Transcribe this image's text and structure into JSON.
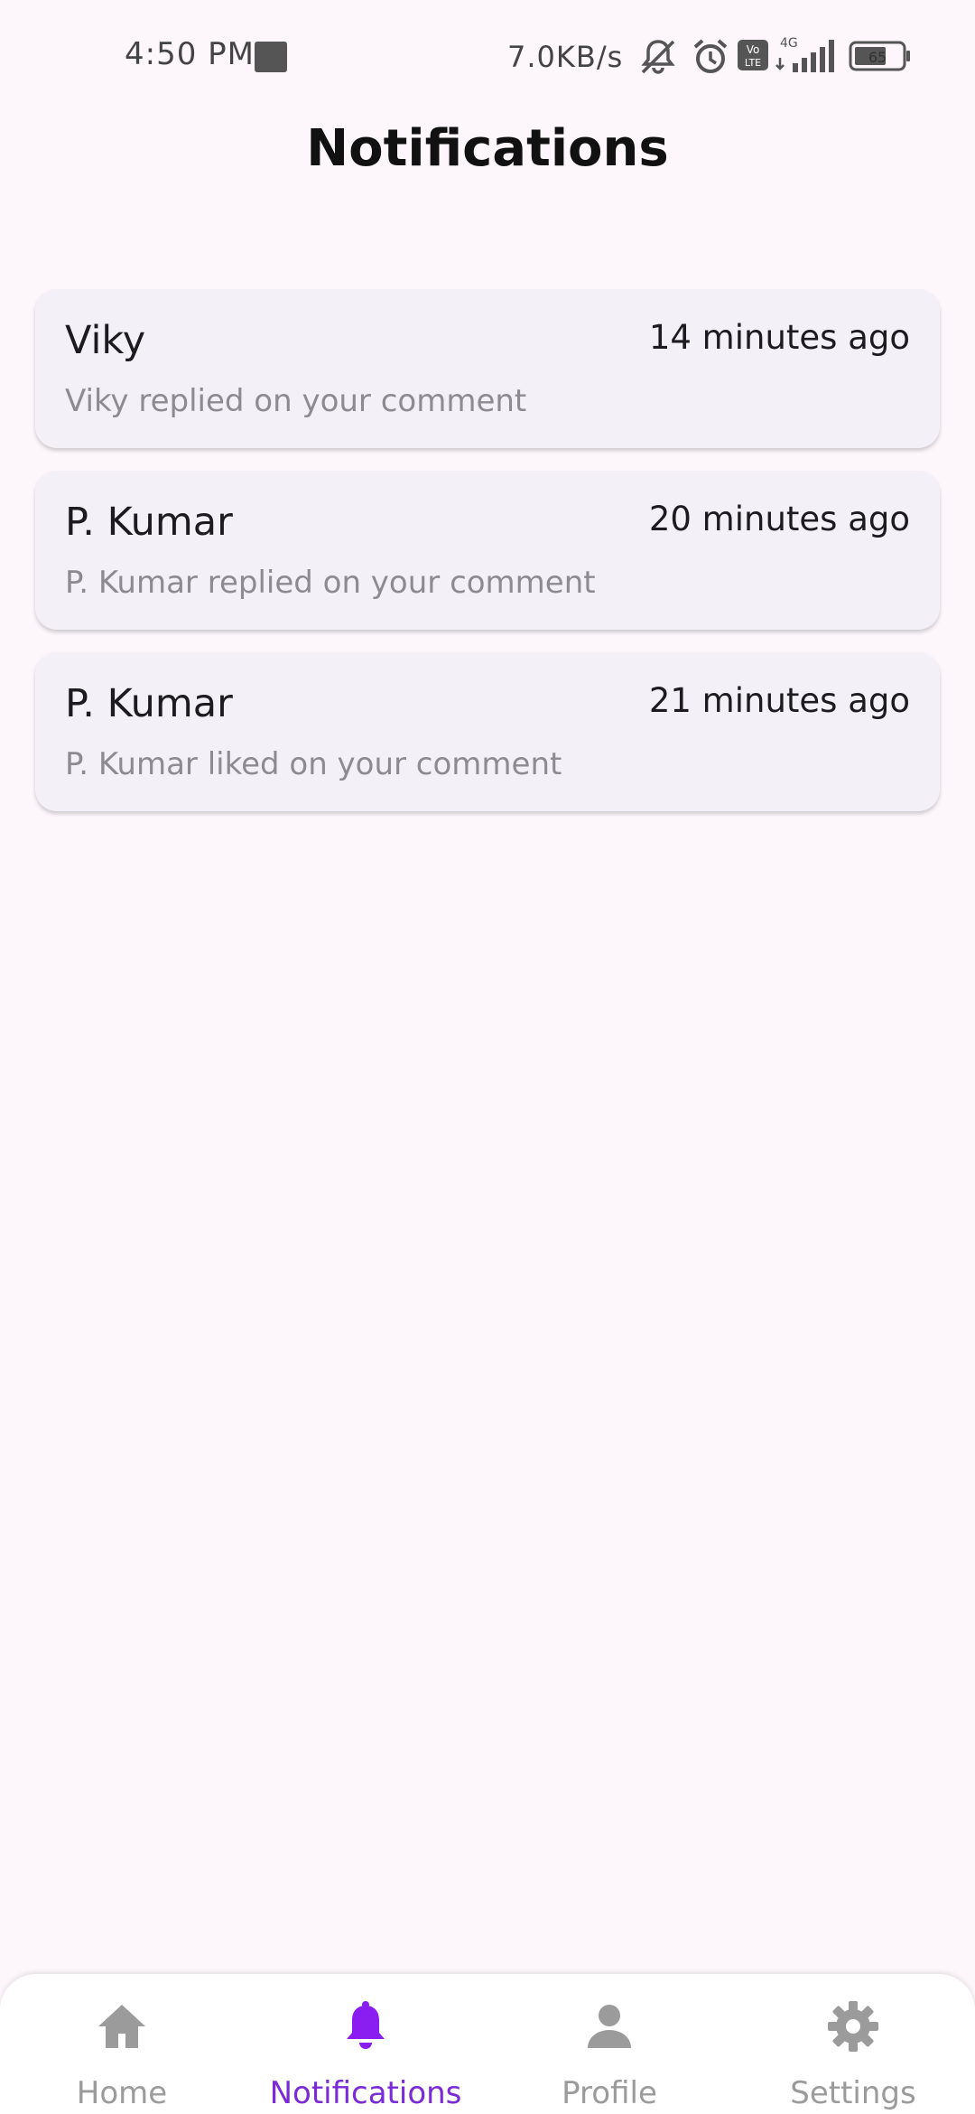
{
  "status_bar": {
    "time": "4:50 PM",
    "net_speed": "7.0KB/s",
    "network_type": "4G",
    "volte": "Vo LTE",
    "battery_level": "65"
  },
  "header": {
    "title": "Notifications"
  },
  "notifications": [
    {
      "name": "Viky",
      "time": "14 minutes ago",
      "message": "Viky replied on your comment"
    },
    {
      "name": "P. Kumar",
      "time": "20 minutes ago",
      "message": "P. Kumar replied on your comment"
    },
    {
      "name": "P. Kumar",
      "time": "21 minutes ago",
      "message": "P. Kumar liked on your comment"
    }
  ],
  "bottom_nav": {
    "items": [
      {
        "label": "Home",
        "icon": "home-icon"
      },
      {
        "label": "Notifications",
        "icon": "bell-icon",
        "active": true
      },
      {
        "label": "Profile",
        "icon": "person-icon"
      },
      {
        "label": "Settings",
        "icon": "gear-icon"
      }
    ]
  },
  "colors": {
    "background": "#fdf7fb",
    "card": "#f4f0f8",
    "accent": "#7b2bd6",
    "inactive": "#9b9b9b"
  }
}
